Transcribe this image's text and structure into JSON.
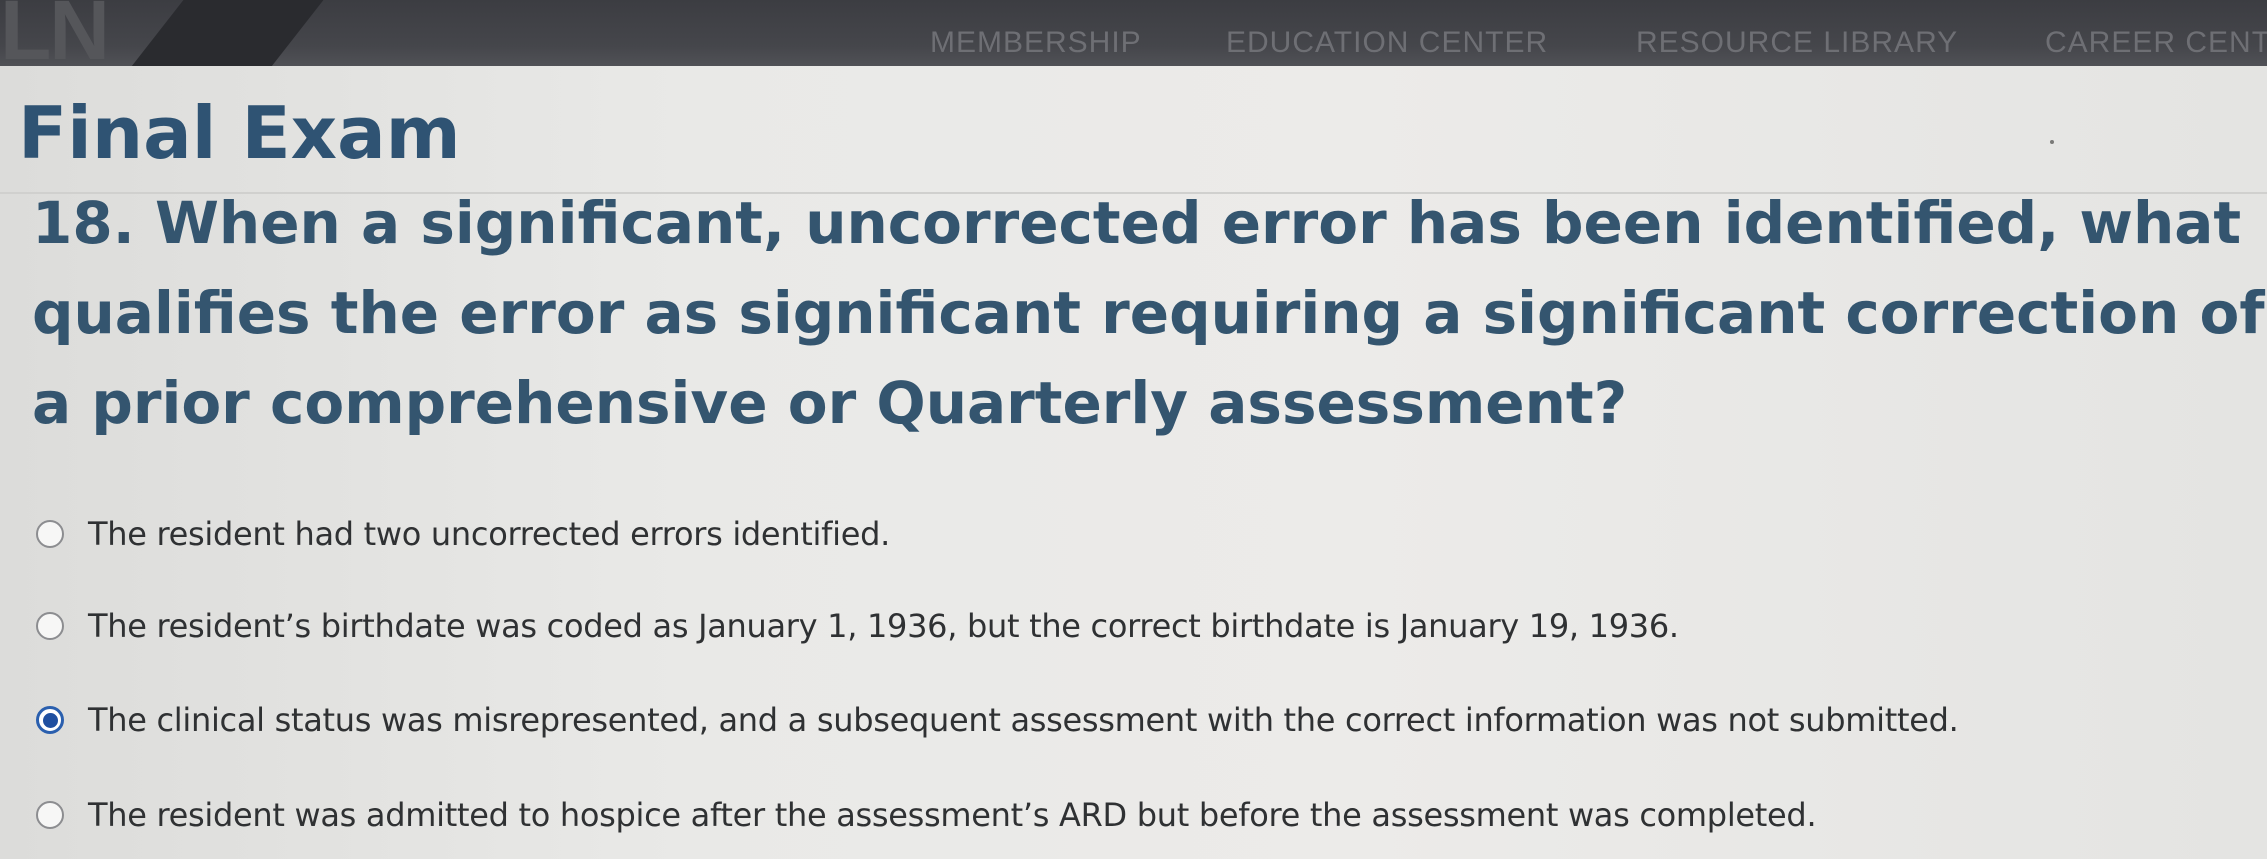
{
  "header": {
    "logo_text": "LN",
    "nav": {
      "membership": "MEMBERSHIP",
      "education": "EDUCATION CENTER",
      "resource": "RESOURCE LIBRARY",
      "career": "CAREER CENT"
    }
  },
  "exam": {
    "title": "Final Exam",
    "question": {
      "number": "18.",
      "lines": [
        "18. When a significant, uncorrected error has been identified, what",
        "qualifies the error as significant requiring a significant correction of",
        "a prior comprehensive or Quarterly assessment?"
      ]
    },
    "options": [
      {
        "label": "The resident had two uncorrected errors identified.",
        "selected": false
      },
      {
        "label": "The resident’s birthdate was coded as January 1, 1936, but the correct birthdate is January 19, 1936.",
        "selected": false
      },
      {
        "label": "The clinical status was misrepresented, and a subsequent assessment with the correct information was not submitted.",
        "selected": true
      },
      {
        "label": "The resident was admitted to hospice after the assessment’s ARD but before the assessment was completed.",
        "selected": false
      }
    ]
  },
  "colors": {
    "heading": "#2f5373",
    "radio_selected": "#1f4fa0",
    "body_text": "#2f3133",
    "nav_bar": "#45464b"
  }
}
